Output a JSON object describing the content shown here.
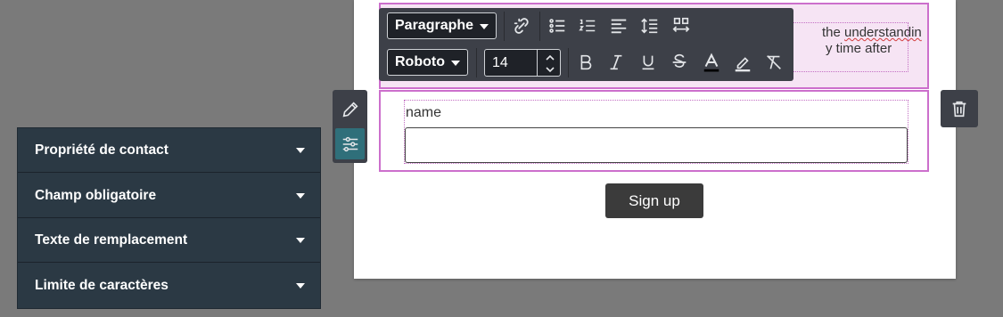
{
  "toolbar": {
    "block_type": "Paragraphe",
    "font_family": "Roboto",
    "font_size": "14",
    "icons": [
      "unlink-icon",
      "bulleted-list-icon",
      "numbered-list-icon",
      "align-left-icon",
      "line-height-icon",
      "spacing-icon",
      "bold-icon",
      "italic-icon",
      "underline-icon",
      "strikethrough-icon",
      "text-color-icon",
      "highlight-icon",
      "clear-format-icon"
    ]
  },
  "canvas": {
    "text_line1_visible": "the ",
    "text_line1_misspelled": "understandin",
    "text_line2_visible": "y time after",
    "field_label": "name",
    "field_value": "",
    "signup_label": "Sign up"
  },
  "side_tools": {
    "icons": [
      "pencil-icon",
      "sliders-icon"
    ]
  },
  "trash": {
    "icon": "trash-icon"
  },
  "properties": {
    "items": [
      {
        "label": "Propriété de contact"
      },
      {
        "label": "Champ obligatoire"
      },
      {
        "label": "Texte de remplacement"
      },
      {
        "label": "Limite de caractères"
      }
    ]
  },
  "colors": {
    "selection_border": "#cc6fcc",
    "selection_fill": "#f6e4f4",
    "toolbar_bg": "#3d4048",
    "panel_bg": "#2b3944",
    "active_tool": "#2f6f7a",
    "button_bg": "#3b3b3b"
  }
}
